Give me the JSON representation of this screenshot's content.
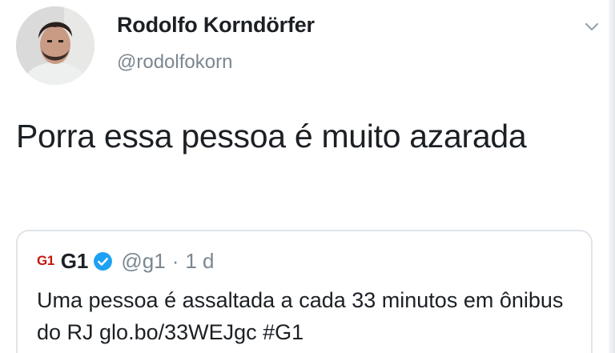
{
  "tweet": {
    "display_name": "Rodolfo Korndörfer",
    "handle": "@rodolfokorn",
    "text": "Porra essa pessoa é muito azarada",
    "menu_icon": "chevron-down-icon",
    "avatar_icon": "user-avatar"
  },
  "quoted_tweet": {
    "logo_text": "G1",
    "name": "G1",
    "verified_icon": "verified-badge-icon",
    "handle": "@g1",
    "separator": "·",
    "time": "1 d",
    "text": "Uma pessoa é assaltada a cada 33 minutos em ônibus do RJ glo.bo/33WEJgc #G1"
  },
  "colors": {
    "text": "#1c2024",
    "secondary": "#7b8791",
    "verified": "#1da1f2",
    "g1_red": "#c4170c",
    "border": "#dfe5ea"
  }
}
